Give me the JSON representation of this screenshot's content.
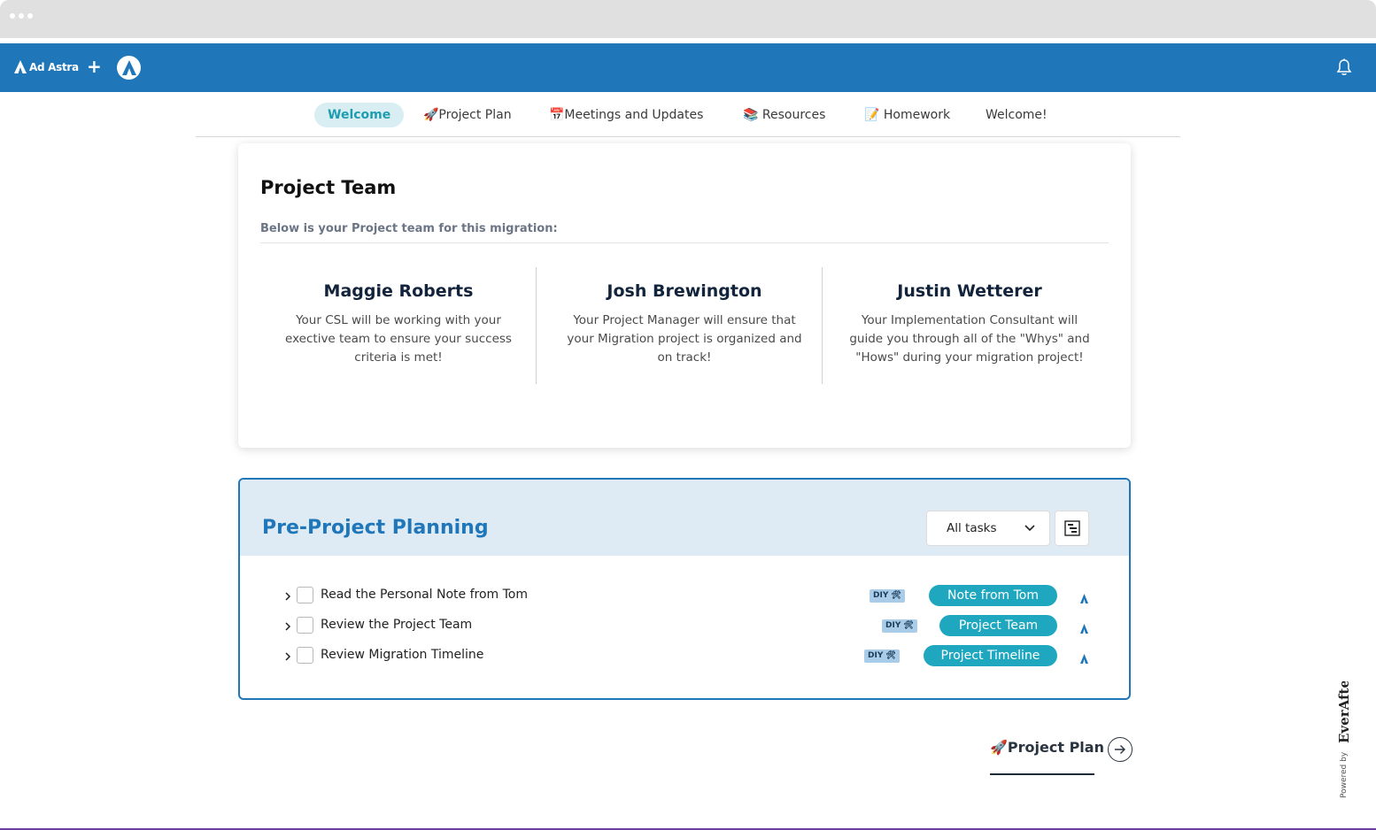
{
  "topbar": {
    "logo_text": "Ad Astra",
    "plus_label": "+",
    "brand_color": "#1f77ba"
  },
  "tabs": [
    {
      "label": "Welcome",
      "active": true
    },
    {
      "label": "🚀Project Plan",
      "active": false
    },
    {
      "label": "📅Meetings and Updates",
      "active": false
    },
    {
      "label": "📚 Resources",
      "active": false
    },
    {
      "label": "📝 Homework",
      "active": false
    },
    {
      "label": "Welcome!",
      "active": false
    }
  ],
  "team": {
    "title": "Project Team",
    "subtitle": "Below is your Project team for this migration:",
    "members": [
      {
        "name": "Maggie Roberts",
        "desc": "Your CSL will be working with your exective team to ensure your success criteria is met!"
      },
      {
        "name": "Josh Brewington",
        "desc": "Your Project Manager will ensure that your Migration project is organized and on track!"
      },
      {
        "name": "Justin Wetterer",
        "desc": "Your Implementation Consultant will guide you through all of the \"Whys\" and \"Hows\" during your migration project!"
      }
    ]
  },
  "planning": {
    "title": "Pre-Project Planning",
    "filter_value": "All tasks",
    "tasks": [
      {
        "label": "Read the Personal Note from Tom",
        "badge": "DIY 🛠",
        "pill": "Note from Tom",
        "checked": false
      },
      {
        "label": "Review the Project Team",
        "badge": "DIY 🛠",
        "pill": "Project Team",
        "checked": false
      },
      {
        "label": "Review Migration Timeline",
        "badge": "DIY 🛠",
        "pill": "Project Timeline",
        "checked": false
      }
    ]
  },
  "footer": {
    "next_label": "🚀Project Plan",
    "powered_by": "Powered by",
    "powered_brand": "EverAfter"
  }
}
